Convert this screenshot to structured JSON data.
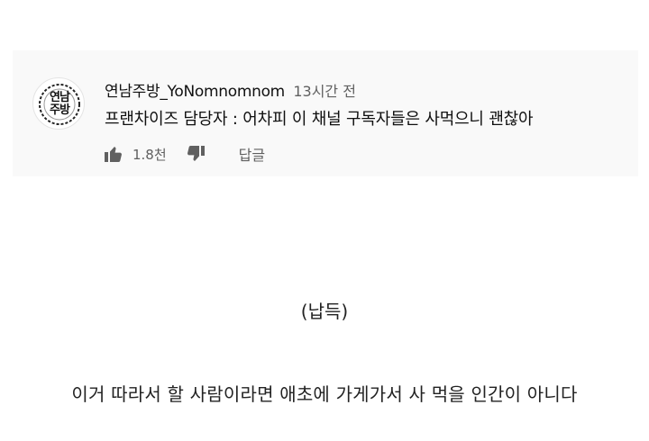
{
  "comment": {
    "author": "연남주방_YoNomnomnom",
    "timestamp": "13시간 전",
    "text": "프랜차이즈 담당자 : 어차피 이 채널 구독자들은 사먹으니 괜찮아",
    "avatar_text_line1": "연남",
    "avatar_text_line2": "주방",
    "like_count": "1.8천",
    "reply_label": "답글",
    "icons": [
      "thumbs-up-icon",
      "thumbs-down-icon"
    ]
  },
  "captions": {
    "line1": "(납득)",
    "line2": "이거 따라서 할 사람이라면 애초에 가게가서 사 먹을 인간이 아니다"
  },
  "colors": {
    "card_background": "#f9f9f9",
    "secondary_text": "#606060",
    "primary_text": "#0f0f0f"
  }
}
